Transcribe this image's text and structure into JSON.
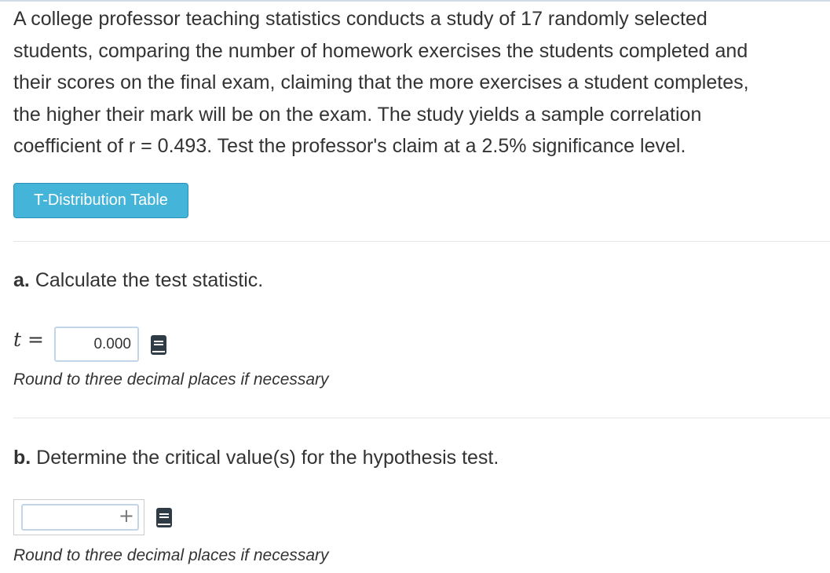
{
  "problem": {
    "line1": "A college professor teaching statistics conducts a study of 17 randomly selected",
    "line2": "students, comparing the number of homework exercises the students completed and",
    "line3": "their scores on the final exam, claiming that the more exercises a student completes,",
    "line4": "the higher their mark will be on the exam. The study yields a sample correlation",
    "line5": "coefficient of r = 0.493. Test the professor's claim at a 2.5% significance level."
  },
  "tdist_button_label": "T-Distribution Table",
  "part_a": {
    "letter": "a.",
    "question": "Calculate the test statistic.",
    "variable": "t",
    "equals": "=",
    "input_value": "0.000",
    "hint": "Round to three decimal places if necessary",
    "icon": "book-icon"
  },
  "part_b": {
    "letter": "b.",
    "question": "Determine the critical value(s) for the hypothesis test.",
    "input_value": "",
    "plus_symbol": "+",
    "hint": "Round to three decimal places if necessary",
    "icon": "book-icon"
  },
  "colors": {
    "button_bg": "#45b4d9",
    "button_text": "#ffffff",
    "input_border": "#c3d6e9",
    "text": "#333333",
    "divider": "#e5e5e5",
    "icon": "#2f3b45"
  }
}
